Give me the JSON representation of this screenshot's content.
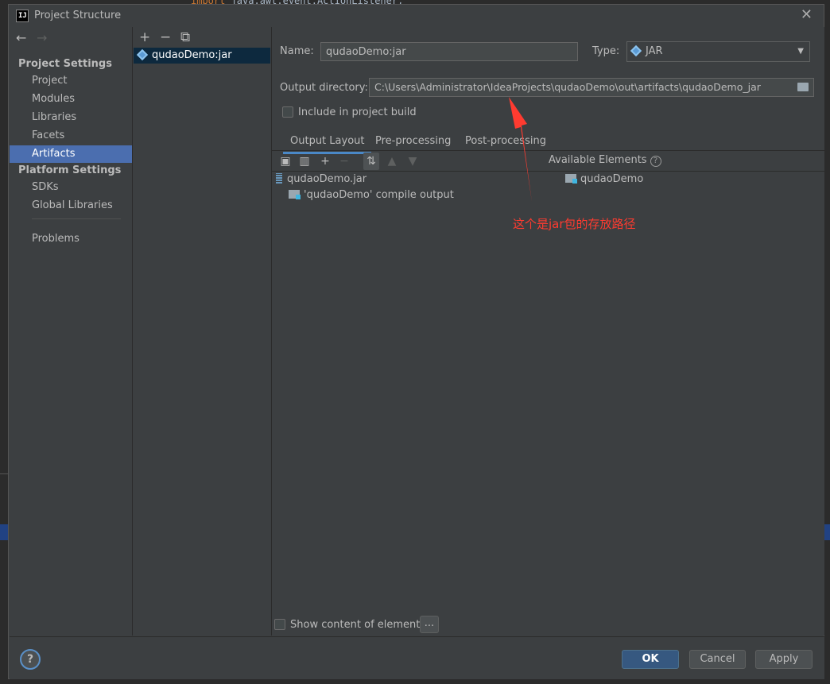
{
  "background": {
    "code_line_keyword": "import",
    "code_line_rest": " java.awt.event.ActionListener;"
  },
  "dialog": {
    "title": "Project Structure",
    "close_glyph": "✕"
  },
  "nav": {
    "back_glyph": "←",
    "forward_glyph": "→",
    "project_settings_header": "Project Settings",
    "project_settings_items": [
      "Project",
      "Modules",
      "Libraries",
      "Facets",
      "Artifacts"
    ],
    "selected_item": "Artifacts",
    "platform_settings_header": "Platform Settings",
    "platform_settings_items": [
      "SDKs",
      "Global Libraries"
    ],
    "problems": "Problems"
  },
  "artifacts": {
    "toolbar": {
      "add": "+",
      "remove": "−",
      "copy": "⧉"
    },
    "items": [
      "qudaoDemo:jar"
    ]
  },
  "artifact_editor": {
    "name_label": "Name:",
    "name_value": "qudaoDemo:jar",
    "type_label": "Type:",
    "type_value": "JAR",
    "output_dir_label": "Output directory:",
    "output_dir_value": "C:\\Users\\Administrator\\IdeaProjects\\qudaoDemo\\out\\artifacts\\qudaoDemo_jar",
    "include_in_build_label": "Include in project build",
    "include_in_build_checked": false,
    "tabs": [
      "Output Layout",
      "Pre-processing",
      "Post-processing"
    ],
    "active_tab": "Output Layout",
    "layout_tree": [
      {
        "label": "qudaoDemo.jar",
        "icon": "jar-icon"
      },
      {
        "label": "'qudaoDemo' compile output",
        "icon": "module-folder-icon"
      }
    ],
    "available_elements_label": "Available Elements",
    "available_elements": [
      "qudaoDemo"
    ],
    "show_content_label": "Show content of elements",
    "show_content_checked": false,
    "dots_label": "..."
  },
  "annotation": {
    "text": "这个是jar包的存放路径",
    "color": "#ff3b30"
  },
  "footer": {
    "help": "?",
    "ok": "OK",
    "cancel": "Cancel",
    "apply": "Apply"
  },
  "colors": {
    "accent": "#4b6eaf",
    "primary_button": "#365880",
    "selected_row": "#0d293e",
    "panel": "#3c3f41"
  }
}
